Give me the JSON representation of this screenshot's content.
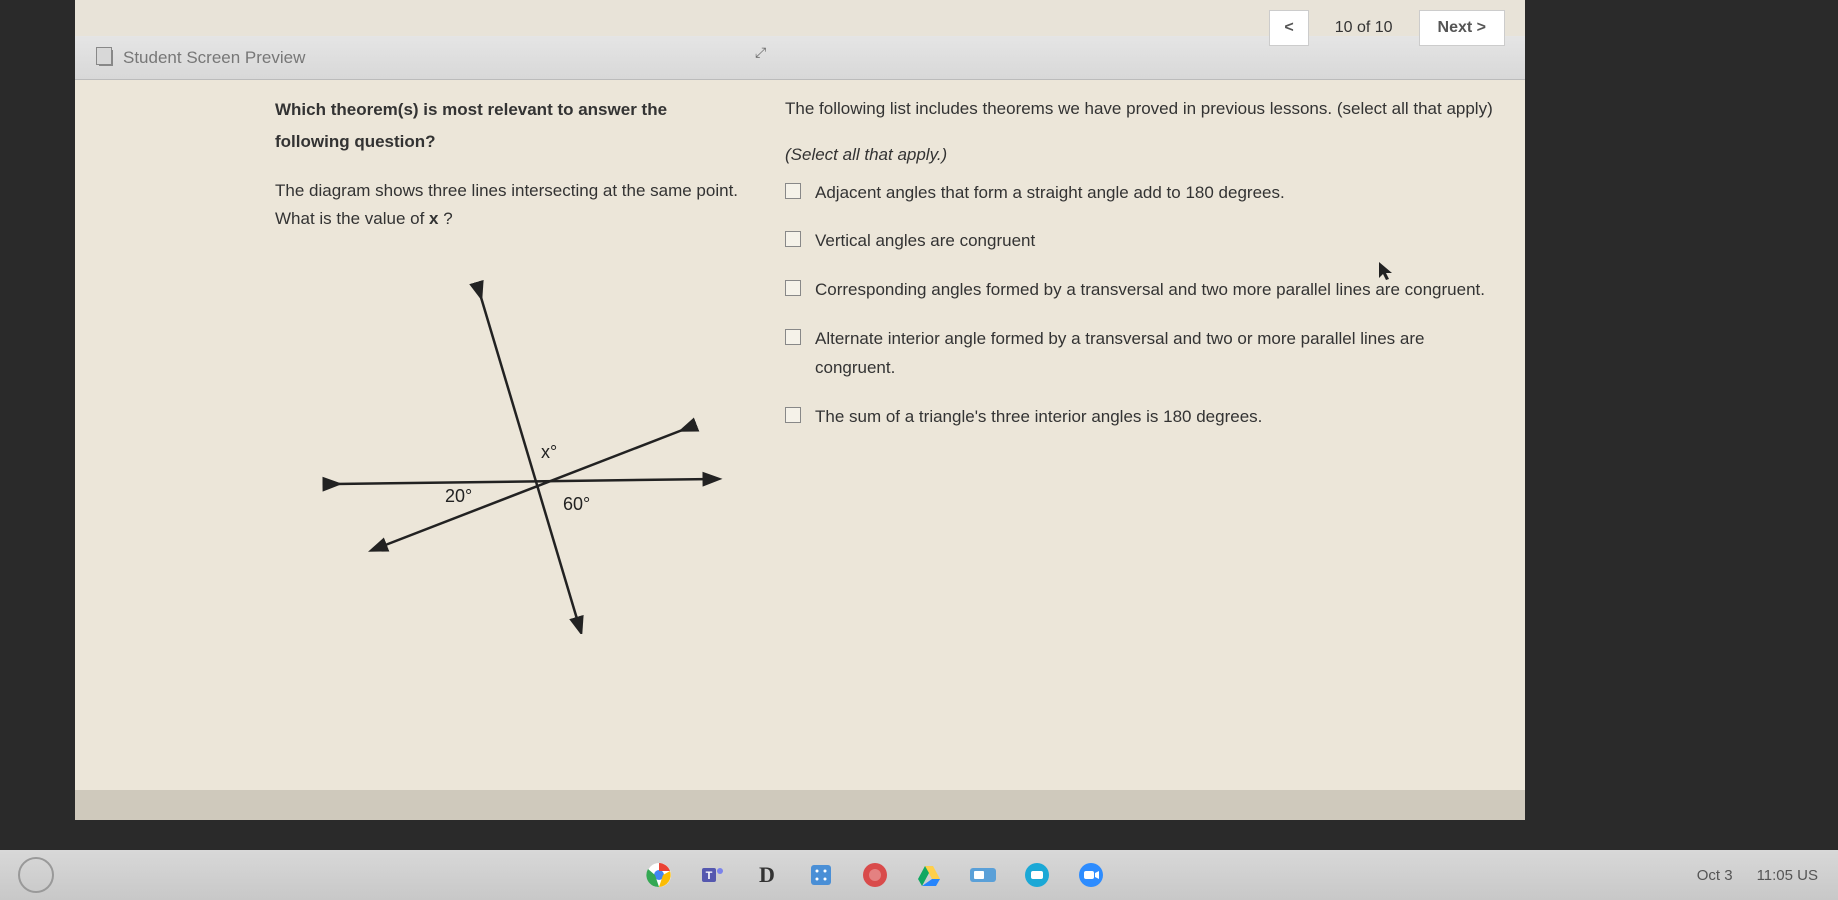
{
  "nav": {
    "prev": "<",
    "indicator": "10 of 10",
    "next": "Next  >"
  },
  "header": {
    "title": "Student Screen Preview"
  },
  "left": {
    "title": "Which theorem(s) is most relevant to answer the following question?",
    "body_line1": "The diagram shows three lines intersecting at the same point.",
    "body_line2_pre": "What is the value of ",
    "body_line2_var": "x",
    "body_line2_post": " ?"
  },
  "diagram": {
    "label_x": "x°",
    "label_20": "20°",
    "label_60": "60°"
  },
  "right": {
    "intro": "The following list includes theorems we have proved in previous lessons. (select all that apply)",
    "hint": "(Select all that apply.)",
    "options": [
      "Adjacent angles that form a straight angle add to 180 degrees.",
      "Vertical angles are congruent",
      "Corresponding angles formed by a transversal and two more parallel lines are congruent.",
      "Alternate interior angle formed by a transversal and two or more parallel lines are congruent.",
      "The sum of a triangle's three interior angles is 180 degrees."
    ]
  },
  "taskbar": {
    "date": "Oct 3",
    "time": "11:05 US"
  }
}
